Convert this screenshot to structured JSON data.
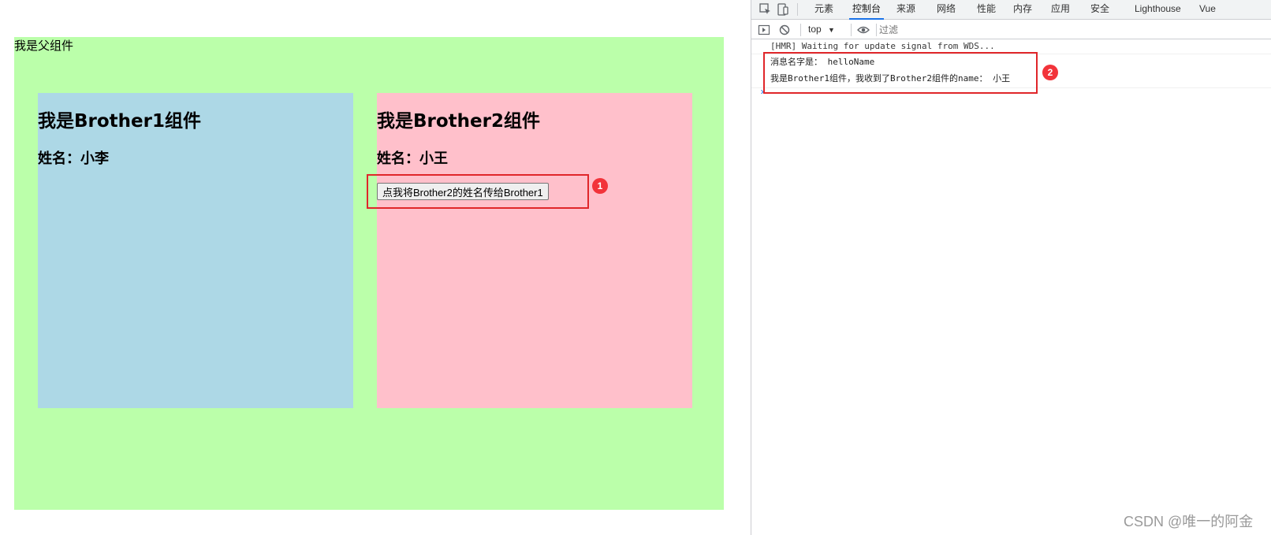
{
  "page": {
    "parent_title": "我是父组件",
    "brother1": {
      "title": "我是Brother1组件",
      "name_label": "姓名：小李"
    },
    "brother2": {
      "title": "我是Brother2组件",
      "name_label": "姓名：小王",
      "button_label": "点我将Brother2的姓名传给Brother1"
    },
    "colors": {
      "parent_bg": "#bbffaa",
      "brother1_bg": "#add8e6",
      "brother2_bg": "#ffc0cb"
    }
  },
  "annotations": {
    "badge1": "1",
    "badge2": "2",
    "color": "#e0262a"
  },
  "devtools": {
    "tabs": [
      "元素",
      "控制台",
      "来源",
      "网络",
      "性能",
      "内存",
      "应用",
      "安全",
      "Lighthouse",
      "Vue"
    ],
    "active_tab": "控制台",
    "context": "top",
    "filter_placeholder": "过滤",
    "console_lines": [
      "[HMR] Waiting for update signal from WDS...",
      "消息名字是： helloName",
      "我是Brother1组件，我收到了Brother2组件的name： 小王"
    ],
    "prompt": "›"
  },
  "watermark": "CSDN @唯一的阿金"
}
